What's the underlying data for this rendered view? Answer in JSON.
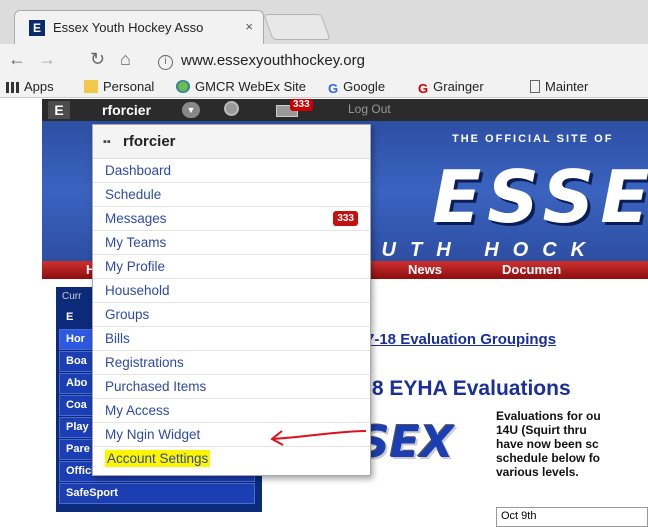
{
  "browser": {
    "tab_title": "Essex Youth Hockey Asso",
    "tab_close": "×",
    "url": "www.essexyouthhockey.org",
    "bookmarks": [
      {
        "label": "Apps",
        "icon": "apps-grid-icon"
      },
      {
        "label": "Personal",
        "icon": "folder-icon"
      },
      {
        "label": "GMCR WebEx Site",
        "icon": "webex-icon"
      },
      {
        "label": "Google",
        "icon": "google-icon"
      },
      {
        "label": "Grainger",
        "icon": "grainger-icon"
      },
      {
        "label": "Mainter",
        "icon": "page-icon"
      }
    ]
  },
  "site_bar": {
    "logo": "E",
    "username": "rforcier",
    "mail_count": "333",
    "logout": "Log Out"
  },
  "banner": {
    "tagline": "THE OFFICIAL SITE OF",
    "big": "ESSE",
    "sub": "OUTH HOCK"
  },
  "main_nav": [
    "Ho",
    "ns",
    "News",
    "Documen"
  ],
  "left_col": {
    "current": "Curr",
    "items": [
      "E",
      "Hor",
      "Boa",
      "Abo",
      "Coa",
      "Play",
      "Pare",
      "Officials",
      "SafeSport"
    ]
  },
  "content": {
    "link": "7-18 Evaluation Groupings",
    "title": ".8 EYHA Evaluations",
    "desc": "Evaluations for ou\n14U (Squirt thru\nhave now been sc\nschedule below fo\nvarious levels.",
    "date": "Oct 9th",
    "logo_text": "SEX"
  },
  "dropdown": {
    "username": "rforcier",
    "items": [
      {
        "label": "Dashboard"
      },
      {
        "label": "Schedule"
      },
      {
        "label": "Messages",
        "badge": "333"
      },
      {
        "label": "My Teams"
      },
      {
        "label": "My Profile"
      },
      {
        "label": "Household"
      },
      {
        "label": "Groups"
      },
      {
        "label": "Bills"
      },
      {
        "label": "Registrations"
      },
      {
        "label": "Purchased Items"
      },
      {
        "label": "My Access"
      },
      {
        "label": "My Ngin Widget"
      },
      {
        "label": "Account Settings",
        "highlight": true
      }
    ]
  },
  "colors": {
    "highlight": "#fdf400",
    "arrow": "#e0101e",
    "link": "#2d4aa6",
    "banner_blue": "#2d4fa3",
    "nav_red": "#b01818"
  }
}
